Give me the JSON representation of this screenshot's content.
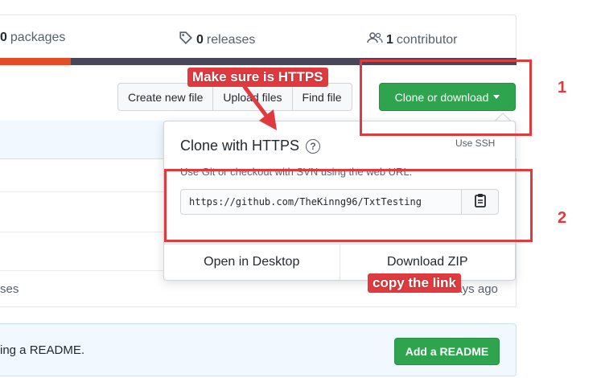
{
  "summary": {
    "packages": {
      "count": "0",
      "label": "packages"
    },
    "releases": {
      "count": "0",
      "label": "releases"
    },
    "contributors": {
      "count": "1",
      "label": "contributor"
    }
  },
  "toolbar": {
    "create_new_file": "Create new file",
    "upload_files": "Upload files",
    "find_file": "Find file",
    "clone_or_download": "Clone or download"
  },
  "clone_panel": {
    "title": "Clone with HTTPS",
    "help_glyph": "?",
    "use_ssh": "Use SSH",
    "description": "Use Git or checkout with SVN using the web URL.",
    "url": "https://github.com/TheKinng96/TxtTesting",
    "open_in_desktop": "Open in Desktop",
    "download_zip": "Download ZIP"
  },
  "file_list": {
    "row_partial_text": "ses",
    "age_text": "days ago"
  },
  "readme_banner": {
    "text": "ing a README.",
    "button": "Add a README"
  },
  "annotations": {
    "make_sure_https": "Make sure is HTTPS",
    "copy_the_link": "copy the link",
    "step1": "1",
    "step2": "2"
  },
  "colors": {
    "accent_green": "#2ea44f",
    "annotation_red": "#e0393e",
    "language_bar": "#4a4659",
    "language_red": "#e34c26"
  }
}
